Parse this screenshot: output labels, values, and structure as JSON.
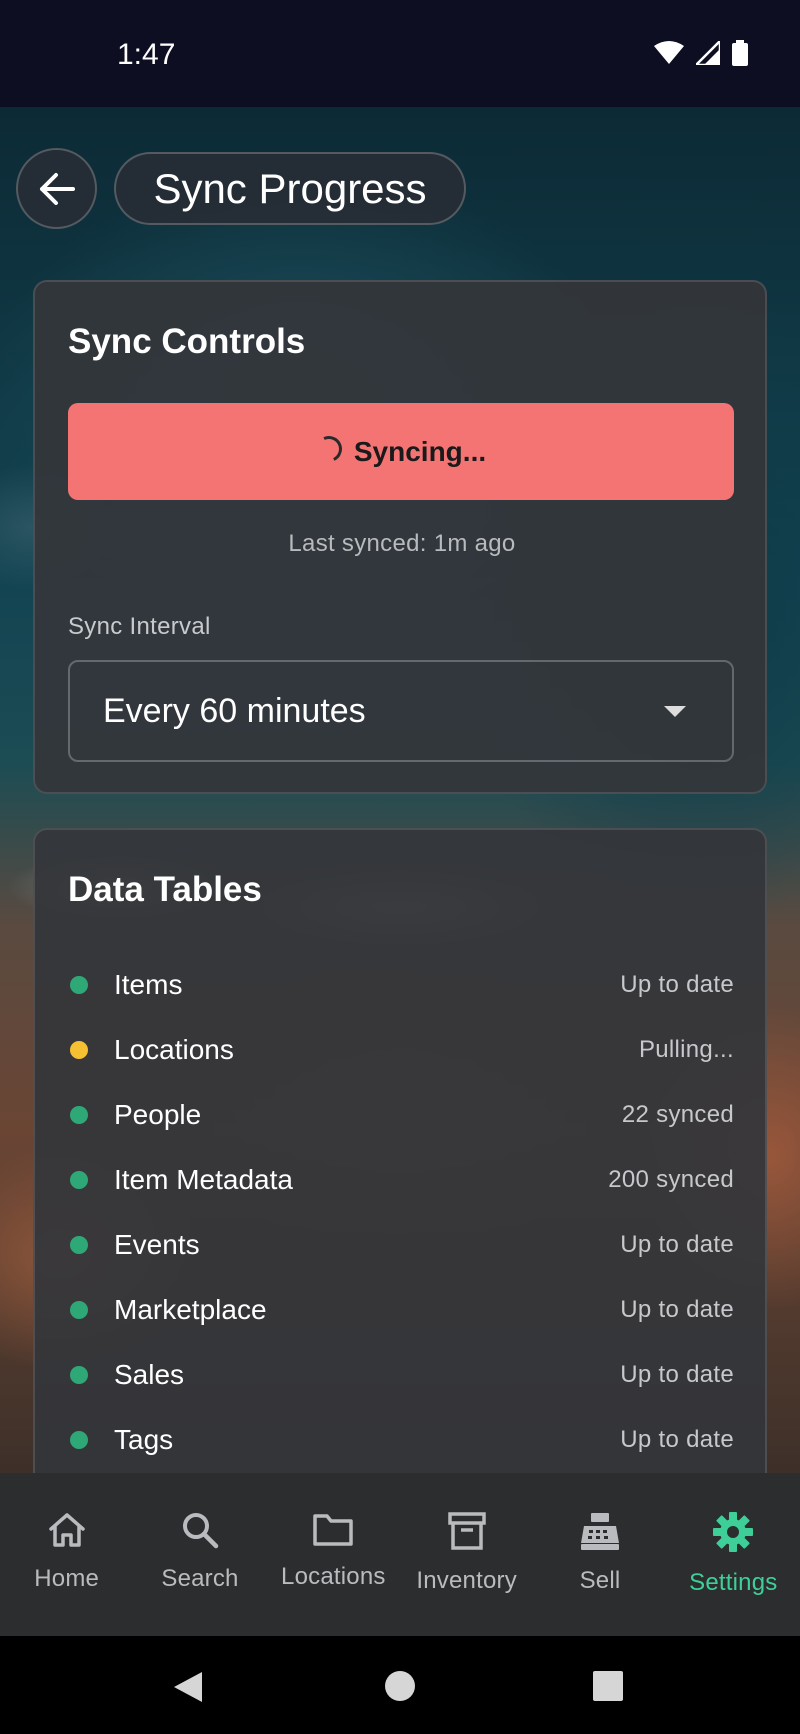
{
  "status_bar": {
    "time": "1:47",
    "icons": [
      "wifi-icon",
      "signal-icon",
      "battery-icon"
    ]
  },
  "header": {
    "back_icon": "arrow-left-icon",
    "title": "Sync Progress"
  },
  "sync_controls": {
    "title": "Sync Controls",
    "sync_button_label": "Syncing...",
    "last_synced": "Last synced: 1m ago",
    "interval_label": "Sync Interval",
    "interval_value": "Every 60 minutes"
  },
  "data_tables": {
    "title": "Data Tables",
    "rows": [
      {
        "name": "Items",
        "status": "Up to date",
        "state": "green"
      },
      {
        "name": "Locations",
        "status": "Pulling...",
        "state": "yellow"
      },
      {
        "name": "People",
        "status": "22 synced",
        "state": "green"
      },
      {
        "name": "Item Metadata",
        "status": "200 synced",
        "state": "green"
      },
      {
        "name": "Events",
        "status": "Up to date",
        "state": "green"
      },
      {
        "name": "Marketplace",
        "status": "Up to date",
        "state": "green"
      },
      {
        "name": "Sales",
        "status": "Up to date",
        "state": "green"
      },
      {
        "name": "Tags",
        "status": "Up to date",
        "state": "green"
      }
    ]
  },
  "bottom_nav": {
    "items": [
      {
        "label": "Home",
        "icon": "home-icon"
      },
      {
        "label": "Search",
        "icon": "search-icon"
      },
      {
        "label": "Locations",
        "icon": "folder-icon"
      },
      {
        "label": "Inventory",
        "icon": "archive-icon"
      },
      {
        "label": "Sell",
        "icon": "cash-register-icon"
      },
      {
        "label": "Settings",
        "icon": "gear-icon",
        "active": true
      }
    ]
  },
  "colors": {
    "accent": "#3ecf98",
    "sync_button": "#f47474",
    "status_green": "#2fa878",
    "status_yellow": "#f5c031"
  }
}
